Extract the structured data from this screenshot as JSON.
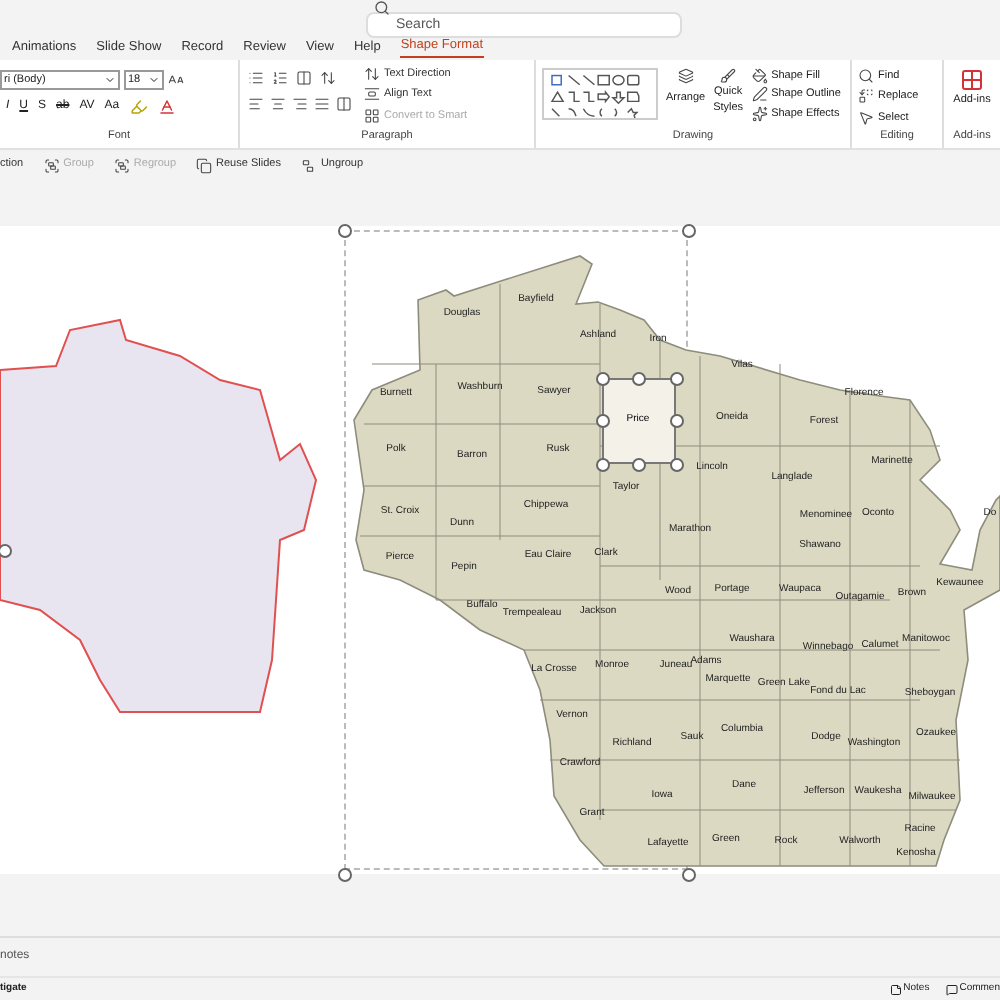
{
  "search": {
    "placeholder": "Search"
  },
  "tabs": [
    {
      "label": "Animations",
      "selected": false
    },
    {
      "label": "Slide Show",
      "selected": false
    },
    {
      "label": "Record",
      "selected": false
    },
    {
      "label": "Review",
      "selected": false
    },
    {
      "label": "View",
      "selected": false
    },
    {
      "label": "Help",
      "selected": false
    },
    {
      "label": "Shape Format",
      "selected": true
    }
  ],
  "font_group": {
    "family": "ri (Body)",
    "size": "18",
    "label": "Font",
    "format_buttons": [
      "I",
      "U",
      "S",
      "ab",
      "AV",
      "Aa"
    ]
  },
  "paragraph_group": {
    "label": "Paragraph",
    "commands": [
      {
        "label": "Text Direction",
        "disabled": false
      },
      {
        "label": "Align Text",
        "disabled": false
      },
      {
        "label": "Convert to Smart",
        "disabled": true
      }
    ]
  },
  "drawing_group": {
    "label": "Drawing",
    "arrange": "Arrange",
    "quick_styles": [
      "Quick",
      "Styles"
    ],
    "commands": [
      "Shape Fill",
      "Shape Outline",
      "Shape Effects"
    ]
  },
  "editing_group": {
    "label": "Editing",
    "commands": [
      "Find",
      "Replace",
      "Select"
    ]
  },
  "addins_group": {
    "label": "Add-ins",
    "button": "Add-ins"
  },
  "toolbar": [
    {
      "label": "ction",
      "disabled": false
    },
    {
      "label": "Group",
      "disabled": true
    },
    {
      "label": "Regroup",
      "disabled": true
    },
    {
      "label": "Reuse Slides",
      "disabled": false
    },
    {
      "label": "Ungroup",
      "disabled": false
    }
  ],
  "counties": [
    {
      "name": "Douglas",
      "selected": false
    },
    {
      "name": "Bayfield",
      "selected": false
    },
    {
      "name": "Ashland",
      "selected": false
    },
    {
      "name": "Iron",
      "selected": false
    },
    {
      "name": "Vilas",
      "selected": false
    },
    {
      "name": "Burnett",
      "selected": false
    },
    {
      "name": "Washburn",
      "selected": false
    },
    {
      "name": "Sawyer",
      "selected": false
    },
    {
      "name": "Price",
      "selected": true
    },
    {
      "name": "Oneida",
      "selected": false
    },
    {
      "name": "Forest",
      "selected": false
    },
    {
      "name": "Florence",
      "selected": false
    },
    {
      "name": "Polk",
      "selected": false
    },
    {
      "name": "Barron",
      "selected": false
    },
    {
      "name": "Rusk",
      "selected": false
    },
    {
      "name": "Lincoln",
      "selected": false
    },
    {
      "name": "Langlade",
      "selected": false
    },
    {
      "name": "Marinette",
      "selected": false
    },
    {
      "name": "Taylor",
      "selected": false
    },
    {
      "name": "St. Croix",
      "selected": false
    },
    {
      "name": "Dunn",
      "selected": false
    },
    {
      "name": "Chippewa",
      "selected": false
    },
    {
      "name": "Menominee",
      "selected": false
    },
    {
      "name": "Oconto",
      "selected": false
    },
    {
      "name": "Marathon",
      "selected": false
    },
    {
      "name": "Shawano",
      "selected": false
    },
    {
      "name": "Pierce",
      "selected": false
    },
    {
      "name": "Eau Claire",
      "selected": false
    },
    {
      "name": "Clark",
      "selected": false
    },
    {
      "name": "Pepin",
      "selected": false
    },
    {
      "name": "Do",
      "selected": false
    },
    {
      "name": "Buffalo",
      "selected": false
    },
    {
      "name": "Trempealeau",
      "selected": false
    },
    {
      "name": "Jackson",
      "selected": false
    },
    {
      "name": "Wood",
      "selected": false
    },
    {
      "name": "Portage",
      "selected": false
    },
    {
      "name": "Waupaca",
      "selected": false
    },
    {
      "name": "Outagamie",
      "selected": false
    },
    {
      "name": "Brown",
      "selected": false
    },
    {
      "name": "Kewaunee",
      "selected": false
    },
    {
      "name": "Waushara",
      "selected": false
    },
    {
      "name": "Winnebago",
      "selected": false
    },
    {
      "name": "Calumet",
      "selected": false
    },
    {
      "name": "Manitowoc",
      "selected": false
    },
    {
      "name": "La Crosse",
      "selected": false
    },
    {
      "name": "Monroe",
      "selected": false
    },
    {
      "name": "Juneau",
      "selected": false
    },
    {
      "name": "Adams",
      "selected": false
    },
    {
      "name": "Marquette",
      "selected": false
    },
    {
      "name": "Green Lake",
      "selected": false
    },
    {
      "name": "Fond du Lac",
      "selected": false
    },
    {
      "name": "Sheboygan",
      "selected": false
    },
    {
      "name": "Vernon",
      "selected": false
    },
    {
      "name": "Columbia",
      "selected": false
    },
    {
      "name": "Dodge",
      "selected": false
    },
    {
      "name": "Ozaukee",
      "selected": false
    },
    {
      "name": "Washington",
      "selected": false
    },
    {
      "name": "Richland",
      "selected": false
    },
    {
      "name": "Sauk",
      "selected": false
    },
    {
      "name": "Crawford",
      "selected": false
    },
    {
      "name": "Iowa",
      "selected": false
    },
    {
      "name": "Dane",
      "selected": false
    },
    {
      "name": "Jefferson",
      "selected": false
    },
    {
      "name": "Waukesha",
      "selected": false
    },
    {
      "name": "Milwaukee",
      "selected": false
    },
    {
      "name": "Grant",
      "selected": false
    },
    {
      "name": "Racine",
      "selected": false
    },
    {
      "name": "Lafayette",
      "selected": false
    },
    {
      "name": "Green",
      "selected": false
    },
    {
      "name": "Rock",
      "selected": false
    },
    {
      "name": "Walworth",
      "selected": false
    },
    {
      "name": "Kenosha",
      "selected": false
    }
  ],
  "notes": {
    "placeholder": "notes"
  },
  "status_bar": {
    "left": "tigate",
    "notes": "Notes",
    "comments": "Commen"
  }
}
